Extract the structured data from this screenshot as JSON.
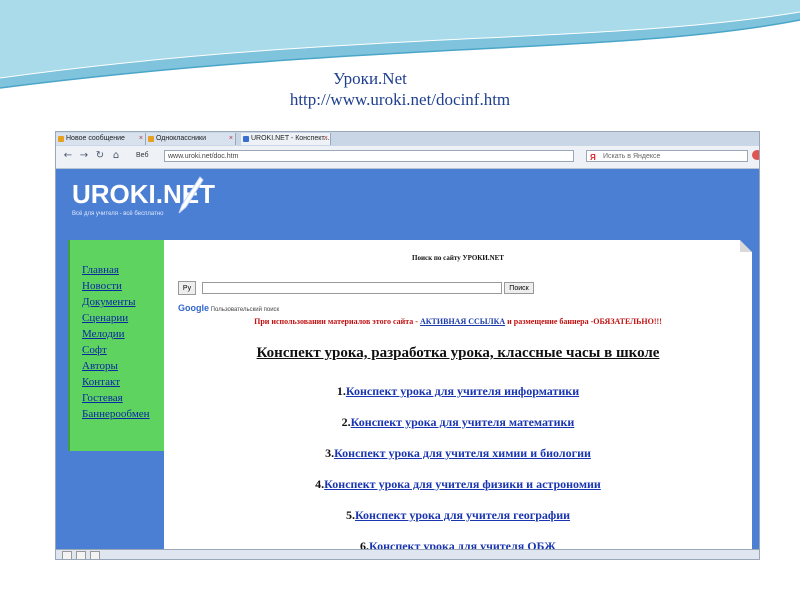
{
  "slide": {
    "title_line1": "Уроки.Net",
    "title_line2": "http://www.uroki.net/docinf.htm"
  },
  "browser": {
    "tabs": [
      {
        "label": "Новое сообщение"
      },
      {
        "label": "Одноклассники"
      },
      {
        "label": "UROKI.NET - Конспект..."
      }
    ],
    "nav": {
      "web_label": "Веб",
      "url": "www.uroki.net/doc.htm",
      "search_placeholder": "Искать в Яндексе",
      "search_brand": "Я"
    }
  },
  "site": {
    "logo": "UROKI.NET",
    "logo_subtitle": "Всё для учителя - всё бесплатно",
    "sidebar": [
      {
        "label": "Главная"
      },
      {
        "label": "Новости"
      },
      {
        "label": "Документы"
      },
      {
        "label": "Сценарии"
      },
      {
        "label": "Мелодии"
      },
      {
        "label": "Софт"
      },
      {
        "label": "Авторы"
      },
      {
        "label": "Контакт"
      },
      {
        "label": "Гостевая"
      },
      {
        "label": "Баннерообмен"
      }
    ],
    "search": {
      "title": "Поиск по сайту УРОКИ.NET",
      "lang_button": "Ру",
      "button": "Поиск",
      "google": "Google",
      "google_label": "Пользовательский поиск"
    },
    "notice": {
      "before": "При использовании материалов этого сайта - ",
      "link": "АКТИВНАЯ ССЫЛКА",
      "after": " и размещение баннера -ОБЯЗАТЕЛЬНО!!!"
    },
    "heading": "Конспект урока, разработка урока, классные часы в школе",
    "lessons": [
      {
        "num": "1.",
        "label": "Конспект урока для учителя информатики"
      },
      {
        "num": "2.",
        "label": "Конспект урока для учителя математики"
      },
      {
        "num": "3.",
        "label": "Конспект урока для учителя химии и биологии"
      },
      {
        "num": "4.",
        "label": "Конспект урока для учителя физики и астрономии"
      },
      {
        "num": "5.",
        "label": "Конспект урока для учителя географии"
      },
      {
        "num": "6.",
        "label": "Конспект урока для учителя ОБЖ"
      }
    ]
  },
  "colors": {
    "page_blue": "#4b7fd3",
    "sidebar_green": "#5fd35f",
    "link_blue": "#1a35b0",
    "notice_red": "#c01010",
    "slide_title": "#1f3f8f"
  }
}
